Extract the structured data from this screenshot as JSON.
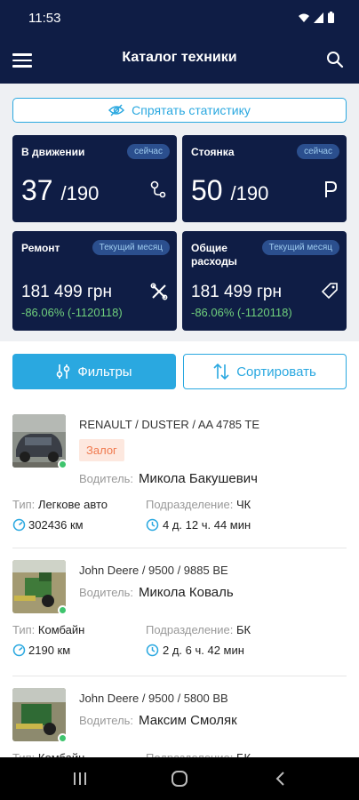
{
  "status": {
    "time": "11:53"
  },
  "appbar": {
    "title": "Каталог техники"
  },
  "stats": {
    "hide_label": "Спрятать статистику",
    "moving": {
      "label": "В движении",
      "badge": "сейчас",
      "value": "37",
      "total": "/190"
    },
    "parking": {
      "label": "Стоянка",
      "badge": "сейчас",
      "value": "50",
      "total": "/190"
    },
    "repair": {
      "label": "Ремонт",
      "badge": "Текущий месяц",
      "amount": "181 499 грн",
      "change": "-86.06% (-1120118)"
    },
    "expenses": {
      "label_line1": "Общие",
      "label_line2": "расходы",
      "badge": "Текущий месяц",
      "amount": "181 499 грн",
      "change": "-86.06% (-1120118)"
    }
  },
  "actions": {
    "filter_label": "Фильтры",
    "sort_label": "Сортировать"
  },
  "labels": {
    "driver": "Водитель:",
    "type": "Тип:",
    "division": "Подразделение:"
  },
  "vehicles": [
    {
      "name": "RENAULT / DUSTER / AA 4785 TE",
      "tag": "Залог",
      "driver": "Микола Бакушевич",
      "type": "Легкове авто",
      "division": "ЧК",
      "mileage": "302436 км",
      "duration": "4 д. 12 ч. 44 мин"
    },
    {
      "name": "John Deere / 9500 / 9885 BE",
      "driver": "Микола Коваль",
      "type": "Комбайн",
      "division": "БК",
      "mileage": "2190 км",
      "duration": "2 д. 6 ч. 42 мин"
    },
    {
      "name": "John Deere / 9500 / 5800 BB",
      "driver": "Максим Смоляк",
      "type": "Комбайн",
      "division": "БК"
    }
  ],
  "colors": {
    "navy": "#0f1d45",
    "accent": "#2aa8e0",
    "positive": "#6fcf7c",
    "tag": "#f07a4f",
    "online": "#3ec46d"
  }
}
